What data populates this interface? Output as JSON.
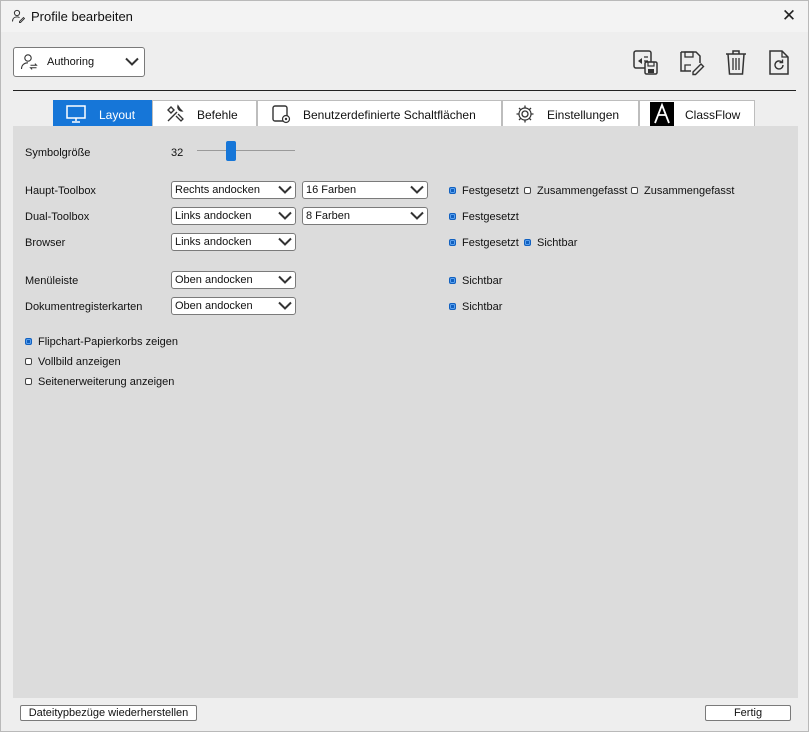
{
  "window": {
    "title": "Profile bearbeiten"
  },
  "profile": {
    "selected": "Authoring"
  },
  "tabs": [
    {
      "label": "Layout",
      "icon": "monitor-icon",
      "active": true
    },
    {
      "label": "Befehle",
      "icon": "tools-icon",
      "active": false
    },
    {
      "label": "Benutzerdefinierte Schaltflächen",
      "icon": "custom-buttons-icon",
      "active": false
    },
    {
      "label": "Einstellungen",
      "icon": "gear-icon",
      "active": false
    },
    {
      "label": "ClassFlow",
      "icon": "classflow-logo-icon",
      "active": false
    }
  ],
  "layout": {
    "symbol_size": {
      "label": "Symbolgröße",
      "value": "32",
      "level": 0.32
    },
    "rows": [
      {
        "label": "Haupt-Toolbox",
        "dock": "Rechts andocken",
        "colors": "16 Farben",
        "options": [
          {
            "label": "Festgesetzt",
            "checked": true
          },
          {
            "label": "Zusammengefasst",
            "checked": false
          },
          {
            "label": "Zusammengefasst",
            "checked": false
          }
        ]
      },
      {
        "label": "Dual-Toolbox",
        "dock": "Links andocken",
        "colors": "8 Farben",
        "options": [
          {
            "label": "Festgesetzt",
            "checked": true
          }
        ]
      },
      {
        "label": "Browser",
        "dock": "Links andocken",
        "options": [
          {
            "label": "Festgesetzt",
            "checked": true
          },
          {
            "label": "Sichtbar",
            "checked": true
          }
        ]
      },
      {
        "label": "Menüleiste",
        "dock": "Oben andocken",
        "options": [
          {
            "label": "Sichtbar",
            "checked": true
          }
        ]
      },
      {
        "label": "Dokumentregisterkarten",
        "dock": "Oben andocken",
        "options": [
          {
            "label": "Sichtbar",
            "checked": true
          }
        ]
      }
    ],
    "checkboxes": [
      {
        "label": "Flipchart-Papierkorbs zeigen",
        "checked": true
      },
      {
        "label": "Vollbild anzeigen",
        "checked": false
      },
      {
        "label": "Seitenerweiterung anzeigen",
        "checked": false
      }
    ]
  },
  "footer": {
    "restore_label": "Dateitypbezüge wiederherstellen",
    "done_label": "Fertig"
  },
  "colors": {
    "accent": "#1676d8",
    "checked": "#1060c0",
    "panel": "#dcdcdc"
  },
  "icons": {
    "profile": "user-switch-icon",
    "close": "close-icon",
    "toolbar": [
      "save-to-device-icon",
      "edit-save-icon",
      "trash-icon",
      "reset-icon"
    ]
  }
}
